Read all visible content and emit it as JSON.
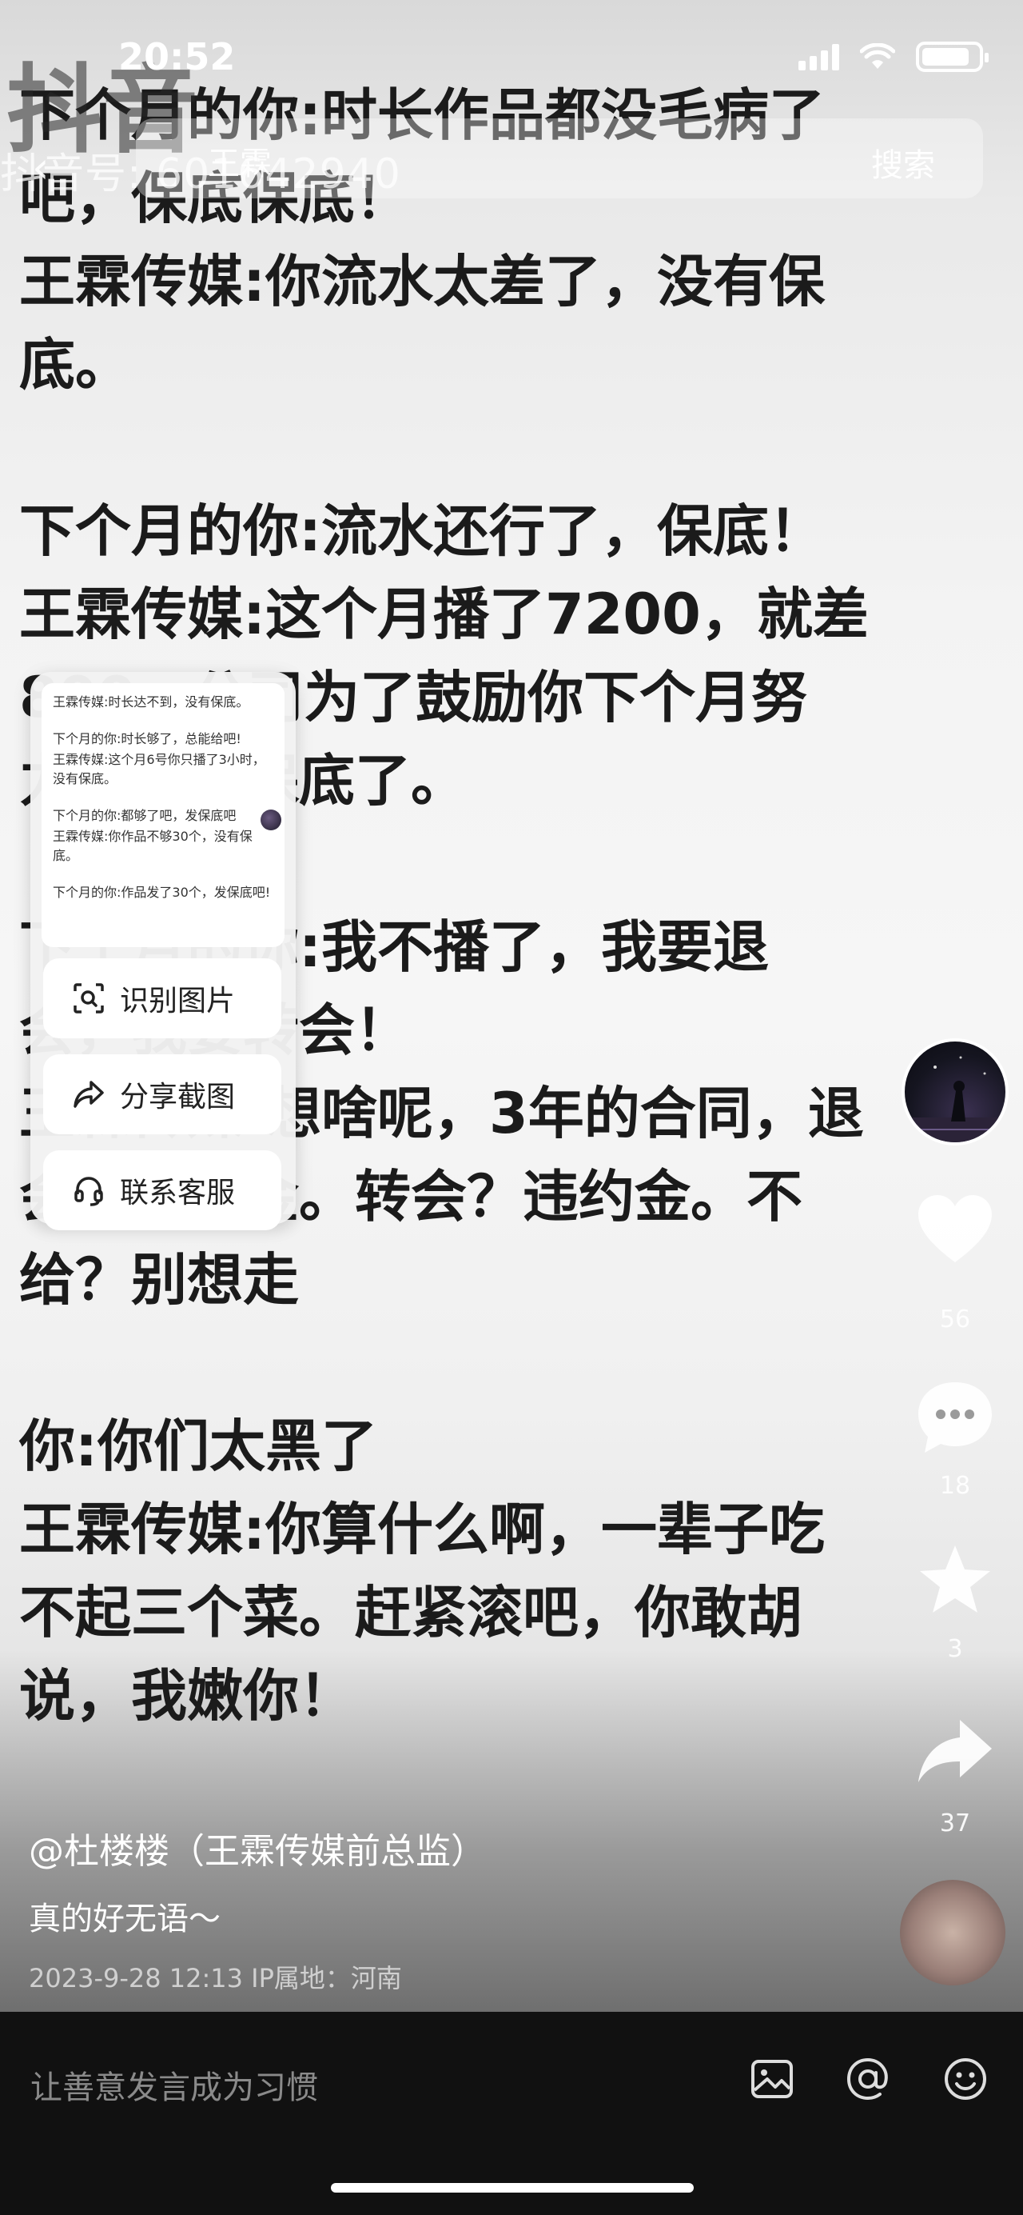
{
  "status": {
    "time": "20:52"
  },
  "top": {
    "logo_text": "抖音",
    "watermark": "抖音号: 601642940",
    "search_text": "王霖",
    "search_button": "搜索"
  },
  "post": {
    "lines": [
      "下个月的你:时长作品都没毛病了",
      "吧，保底保底！",
      "王霖传媒:你流水太差了，没有保",
      "底。",
      "",
      "下个月的你:流水还行了，保底！",
      "王霖传媒:这个月播了7200，就差",
      "800，公司为了鼓励你下个月努",
      "力，不给保底了。",
      "",
      "下个月的你:我不播了，我要退",
      "会，我要转会！",
      "王霖传媒:想啥呢，3年的合同，退",
      "会？违约金。转会？违约金。不",
      "给？别想走",
      "",
      "你:你们太黑了",
      "王霖传媒:你算什么啊，一辈子吃",
      "不起三个菜。赶紧滚吧，你敢胡",
      "说，我嫩你！"
    ]
  },
  "popup": {
    "thumb_lines": [
      "王霖传媒:时长达不到，没有保底。",
      "",
      "下个月的你:时长够了，总能给吧!",
      "王霖传媒:这个月6号你只播了3小时，没有保底。",
      "",
      "下个月的你:都够了吧，发保底吧",
      "王霖传媒:你作品不够30个，没有保底。",
      "",
      "下个月的你:作品发了30个，发保底吧!"
    ],
    "identify_label": "识别图片",
    "share_label": "分享截图",
    "contact_label": "联系客服"
  },
  "rail": {
    "likes": "56",
    "comments": "18",
    "favorites": "3",
    "shares": "37"
  },
  "info": {
    "author": "@杜楼楼（王霖传媒前总监）",
    "caption": "真的好无语～",
    "meta": "2023-9-28 12:13  IP属地：河南"
  },
  "comment_bar": {
    "placeholder": "让善意发言成为习惯"
  }
}
